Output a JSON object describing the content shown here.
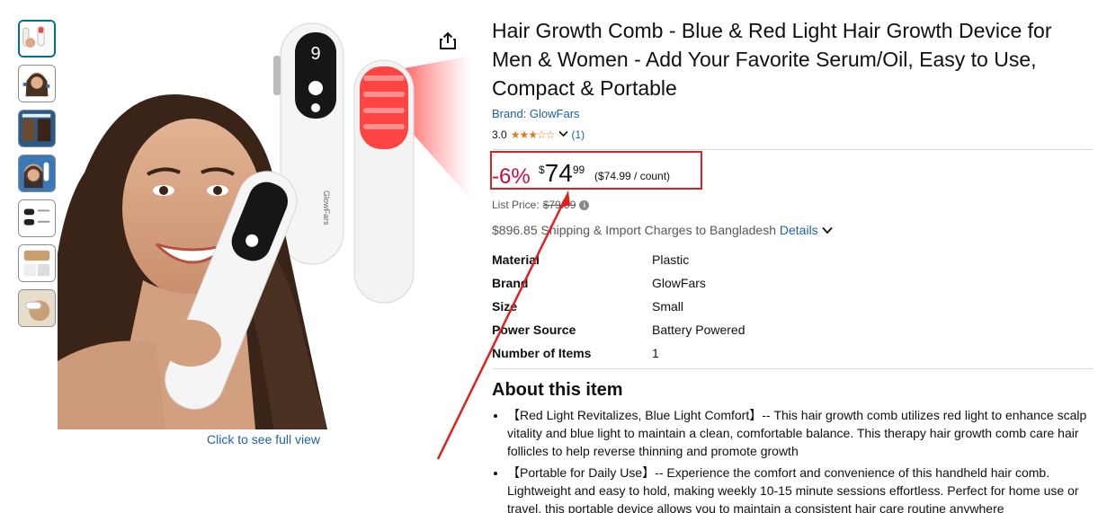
{
  "product": {
    "title": "Hair Growth Comb - Blue & Red Light Hair Growth Device for Men & Women - Add Your Favorite Serum/Oil, Easy to Use, Compact & Portable",
    "brand_link": "Brand: GlowFars",
    "rating_value": "3.0",
    "rating_count": "(1)",
    "stars_filled": 3,
    "stars_total": 5
  },
  "price": {
    "discount": "-6%",
    "currency": "$",
    "whole": "74",
    "fraction": "99",
    "per_unit": "($74.99 / count)",
    "list_price_label": "List Price:",
    "list_price_value": "$79.99"
  },
  "shipping": {
    "text": "$896.85 Shipping & Import Charges to Bangladesh",
    "details_link": "Details"
  },
  "specs": [
    {
      "key": "Material",
      "value": "Plastic"
    },
    {
      "key": "Brand",
      "value": "GlowFars"
    },
    {
      "key": "Size",
      "value": "Small"
    },
    {
      "key": "Power Source",
      "value": "Battery Powered"
    },
    {
      "key": "Number of Items",
      "value": "1"
    }
  ],
  "about": {
    "heading": "About this item",
    "bullets": [
      "【Red Light Revitalizes, Blue Light Comfort】-- This hair growth comb utilizes red light to enhance scalp vitality and blue light to maintain a clean, comfortable balance. This therapy hair growth comb care hair follicles to help reverse thinning and promote growth",
      "【Portable for Daily Use】-- Experience the comfort and convenience of this handheld hair comb. Lightweight and easy to hold, making weekly 10-15 minute sessions effortless. Perfect for home use or travel, this portable device allows you to maintain a consistent hair care routine anywhere"
    ]
  },
  "gallery": {
    "full_view_link": "Click to see full view",
    "thumbnail_count": 7,
    "device_brand_print": "GlowFars",
    "device_display": "9"
  },
  "colors": {
    "link": "#2162A1",
    "discount": "#CC0C39",
    "star": "#DE7921",
    "annotation": "#E0201E"
  },
  "icons": {
    "share": "share-icon",
    "info": "info-icon",
    "chevron": "chevron-down-icon"
  }
}
